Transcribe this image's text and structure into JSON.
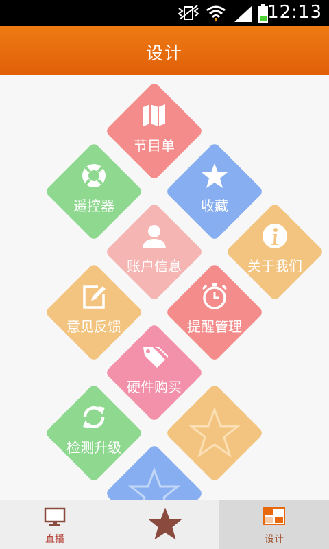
{
  "status_bar": {
    "time": "12:13"
  },
  "header": {
    "title": "设计"
  },
  "tiles": [
    {
      "label": "节目单",
      "icon": "map-icon"
    },
    {
      "label": "遥控器",
      "icon": "lifebuoy-icon"
    },
    {
      "label": "收藏",
      "icon": "star-icon"
    },
    {
      "label": "账户信息",
      "icon": "user-icon"
    },
    {
      "label": "关于我们",
      "icon": "info-icon"
    },
    {
      "label": "意见反馈",
      "icon": "edit-icon"
    },
    {
      "label": "提醒管理",
      "icon": "alarm-clock-icon"
    },
    {
      "label": "硬件购买",
      "icon": "price-tag-icon"
    },
    {
      "label": "检测升级",
      "icon": "refresh-icon"
    }
  ],
  "tab_bar": {
    "items": [
      {
        "label": "直播",
        "icon": "tv-icon"
      },
      {
        "label": "",
        "icon": "star-icon"
      },
      {
        "label": "设计",
        "icon": "grid-icon",
        "selected": true
      }
    ]
  },
  "colors": {
    "header": "#e8680d",
    "pink": "#f38c8a",
    "green": "#8ed88f",
    "blue": "#87aef0",
    "light_pink": "#f4b5b3",
    "orange": "#f3c47f",
    "rose": "#f291a9"
  }
}
